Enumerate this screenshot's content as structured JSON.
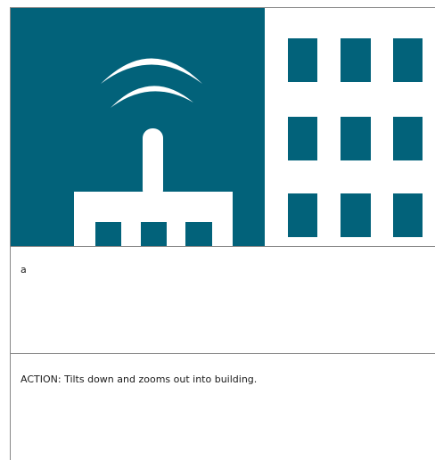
{
  "storyboard": {
    "illustration_icon": "radio-tower-and-office-building",
    "colors": {
      "teal": "#02627a",
      "white": "#ffffff"
    },
    "caption_text": "a",
    "action_text": "ACTION: Tilts down and zooms out into building."
  }
}
